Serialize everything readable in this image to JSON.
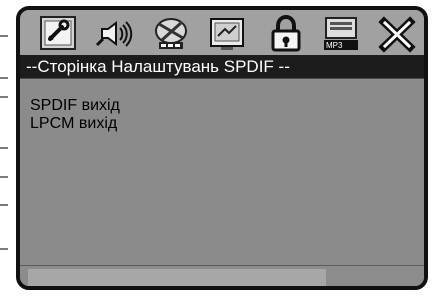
{
  "page_title": "--Сторінка Налаштувань SPDIF --",
  "toolbar": {
    "icons": [
      "general-setup-icon",
      "audio-setup-icon",
      "dolby-setup-icon",
      "video-setup-icon",
      "password-lock-icon",
      "mp3-setup-icon",
      "exit-icon"
    ]
  },
  "menu": {
    "items": [
      {
        "label": "SPDIF вихід"
      },
      {
        "label": "LPCM вихід"
      }
    ]
  },
  "colors": {
    "panel": "#8f8f8f",
    "toolbar": "#a1a1a1",
    "title_bar": "#1c1c1c",
    "status_fill": "#a7a7a7",
    "border": "#111111"
  }
}
